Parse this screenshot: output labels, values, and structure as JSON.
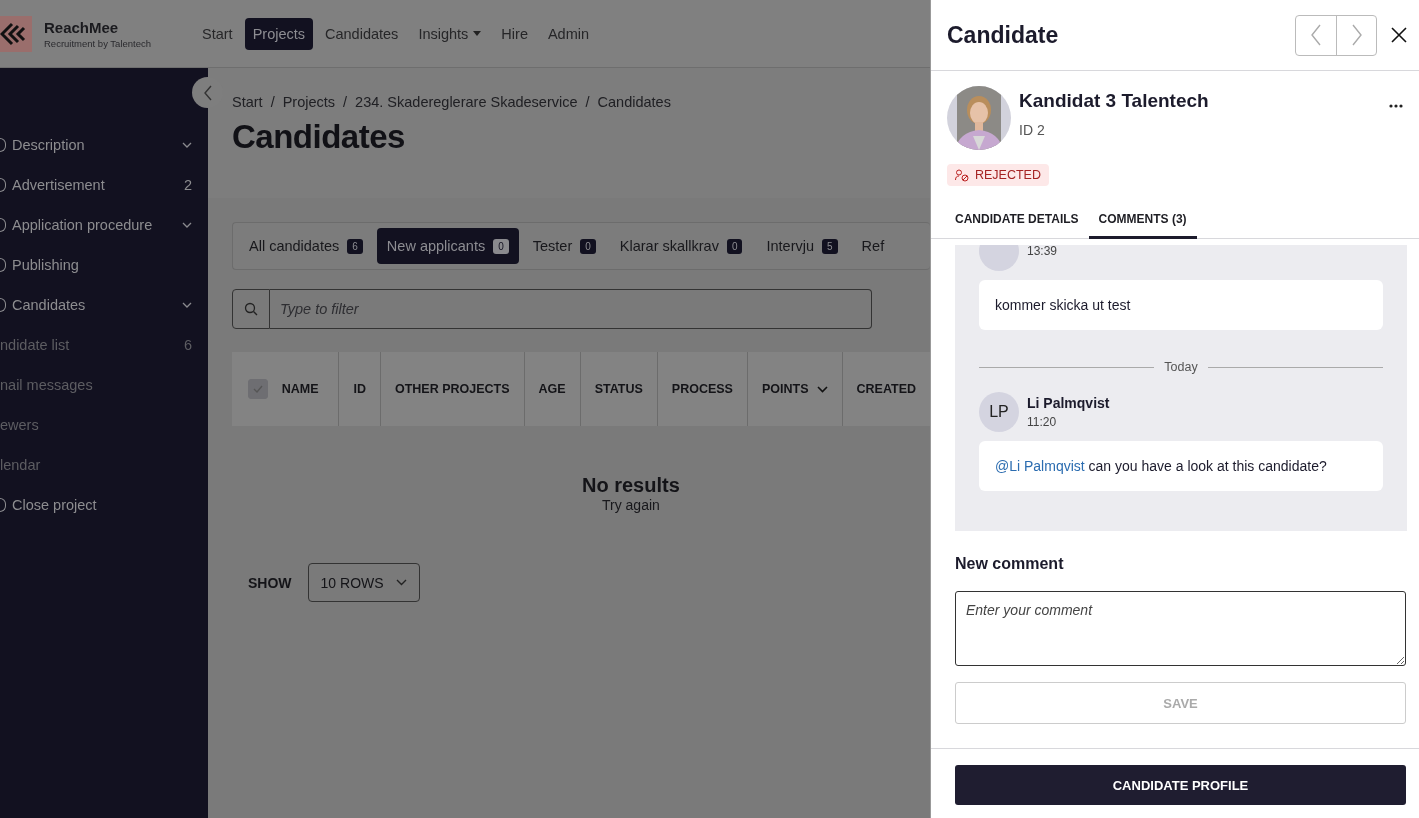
{
  "topbar": {
    "brand": "ReachMee",
    "tagline": "Recruitment by Talentech",
    "nav": [
      {
        "label": "Start",
        "selected": false,
        "dropdown": false
      },
      {
        "label": "Projects",
        "selected": true,
        "dropdown": false
      },
      {
        "label": "Candidates",
        "selected": false,
        "dropdown": false
      },
      {
        "label": "Insights",
        "selected": false,
        "dropdown": true
      },
      {
        "label": "Hire",
        "selected": false,
        "dropdown": false
      },
      {
        "label": "Admin",
        "selected": false,
        "dropdown": false
      }
    ]
  },
  "sidebar": {
    "items": [
      {
        "label": "Description",
        "kind": "main",
        "expandable": true
      },
      {
        "label": "Advertisement",
        "kind": "main",
        "expandable": false,
        "count": "2"
      },
      {
        "label": "Application procedure",
        "kind": "main",
        "expandable": true
      },
      {
        "label": "Publishing",
        "kind": "main",
        "expandable": false
      },
      {
        "label": "Candidates",
        "kind": "main",
        "expandable": true
      },
      {
        "label": "ndidate list",
        "kind": "sub",
        "expandable": false,
        "count": "6"
      },
      {
        "label": "nail messages",
        "kind": "sub",
        "expandable": false
      },
      {
        "label": "ewers",
        "kind": "sub",
        "expandable": false
      },
      {
        "label": "lendar",
        "kind": "sub",
        "expandable": false
      },
      {
        "label": "Close project",
        "kind": "main",
        "expandable": false
      }
    ]
  },
  "breadcrumb": [
    "Start",
    "Projects",
    "234. Skadereglerare Skadeservice",
    "Candidates"
  ],
  "breadcrumb_separator": "/",
  "title": "Candidates",
  "filter_tabs": [
    {
      "label": "All candidates",
      "count": "6",
      "selected": false
    },
    {
      "label": "New applicants",
      "count": "0",
      "selected": true
    },
    {
      "label": "Tester",
      "count": "0",
      "selected": false
    },
    {
      "label": "Klarar skallkrav",
      "count": "0",
      "selected": false
    },
    {
      "label": "Intervju",
      "count": "5",
      "selected": false
    },
    {
      "label": "Ref",
      "selected": false
    }
  ],
  "filter": {
    "placeholder": "Type to filter"
  },
  "table": {
    "select_all_checked": true,
    "columns": [
      {
        "label": "NAME",
        "sorted": false
      },
      {
        "label": "ID",
        "sorted": false
      },
      {
        "label": "OTHER PROJECTS",
        "sorted": false
      },
      {
        "label": "AGE",
        "sorted": false
      },
      {
        "label": "STATUS",
        "sorted": false
      },
      {
        "label": "PROCESS",
        "sorted": false
      },
      {
        "label": "POINTS",
        "sorted": true
      },
      {
        "label": "CREATED",
        "sorted": false
      }
    ],
    "empty_title": "No results",
    "empty_hint": "Try again"
  },
  "pagination": {
    "label": "SHOW",
    "rows": "10 ROWS"
  },
  "panel": {
    "title": "Candidate",
    "name": "Kandidat 3 Talentech",
    "id": "ID 2",
    "status": "REJECTED",
    "tabs": [
      {
        "label": "CANDIDATE DETAILS",
        "selected": false
      },
      {
        "label": "COMMENTS (3)",
        "selected": true
      }
    ],
    "comments": [
      {
        "kind": "comment",
        "time": "13:39",
        "text": "kommer skicka ut test"
      },
      {
        "kind": "divider",
        "label": "Today"
      },
      {
        "kind": "comment",
        "initials": "LP",
        "author": "Li Palmqvist",
        "time": "11:20",
        "mention": "@Li Palmqvist",
        "text": " can you have a look at this candidate?"
      }
    ],
    "new_comment_label": "New comment",
    "comment_placeholder": "Enter your comment",
    "save": "SAVE",
    "profile_button": "CANDIDATE PROFILE"
  }
}
